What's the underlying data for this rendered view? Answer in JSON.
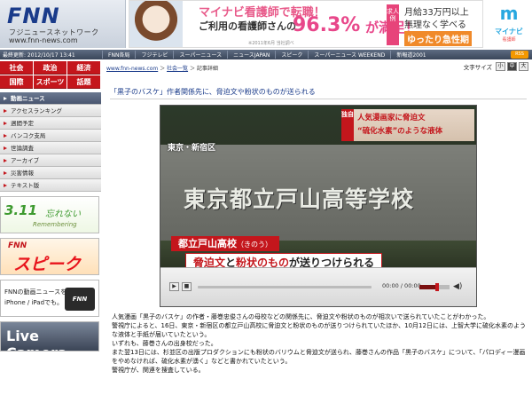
{
  "header": {
    "logo": "FNN",
    "logo_sub1": "フジニュースネットワーク",
    "logo_sub2": "www.fnn-news.com",
    "ad": {
      "line1": "マイナビ看護師で転職！",
      "line2": "ご利用の看護師さんの",
      "percent": "96.3%",
      "satisfied": "が満足！",
      "note": "※2011年6月 当社調べ",
      "badge": "求人例",
      "right1": "月給33万円以上",
      "right2": "無理なく学べる",
      "right3": "ゆったり急性期"
    },
    "mynavi": {
      "mark": "m",
      "label": "マイナビ",
      "sub": "看護師"
    }
  },
  "gnav": {
    "update_time": "最終更新: 2012/10/17 13:41",
    "items": [
      "FNN各局",
      "フジテレビ",
      "スーパーニュース",
      "ニュースJAPAN",
      "スピーク",
      "スーパーニュース WEEKEND",
      "新報道2001"
    ],
    "rss": "RSS"
  },
  "sidebar": {
    "categories": [
      "社会",
      "政治",
      "経済",
      "国際",
      "スポーツ",
      "話題"
    ],
    "menu": [
      "動画ニュース",
      "アクセスランキング",
      "週間予定",
      "バンコク支局",
      "世論調査",
      "アーカイブ",
      "災害情報",
      "テキスト版"
    ],
    "banners": {
      "b311": {
        "t1": "3.11",
        "t2": "忘れない",
        "t3": "Remembering"
      },
      "speak": {
        "t1": "FNN",
        "t2": "スピーク"
      },
      "iphone": {
        "t1": "FNNの動画ニュースを",
        "t2": "iPhone / iPadでも。",
        "logo": "FNN"
      },
      "live": {
        "t1": "Live Camera"
      }
    }
  },
  "main": {
    "breadcrumb": {
      "home": "www.fnn-news.com",
      "sep1": " ＞ ",
      "section": "社会一覧",
      "sep2": " ＞ ",
      "current": "記事詳細"
    },
    "text_size": {
      "label": "文字サイズ",
      "small": "小",
      "medium": "中",
      "large": "大"
    },
    "title": "「黒子のバスケ」作者関係先に、脅迫文や粉状のものが送られる",
    "video": {
      "location": "東京・新宿区",
      "school_sign": "東京都立戸山高等学校",
      "top_tag": "独自",
      "top_line1": "人気漫画家に脅迫文",
      "top_line2": "“硫化水素”のような液体",
      "bottom_name": "都立戸山高校",
      "bottom_ruby": "（きのう）",
      "bottom_main_a": "脅迫文",
      "bottom_main_b": "と",
      "bottom_main_c": "粉状のもの",
      "bottom_main_d": "が送りつけられる",
      "time": "00:00 / 00:00",
      "volume": 0.6
    },
    "article": [
      "人気漫画「黒子のバスケ」の作者・藤巻忠俊さんの母校などの関係先に、脅迫文や粉状のものが相次いで送られていたことがわかった。",
      "警視庁によると、16日、東京・新宿区の都立戸山高校に脅迫文と粉状のものが送りつけられていたほか、10月12日には、上智大学に硫化水素のような液体と手紙が届いていたという。",
      "いずれも、藤巻さんの出身校だった。",
      "また翌13日には、杉並区の出版プロダクションにも粉状のバリウムと脅迫文が送られ、藤巻さんの作品「黒子のバスケ」について、「パロディー漫画をやめなければ、硫化水素が湧く」などと書かれていたという。",
      "警視庁が、関連を捜査している。"
    ]
  }
}
